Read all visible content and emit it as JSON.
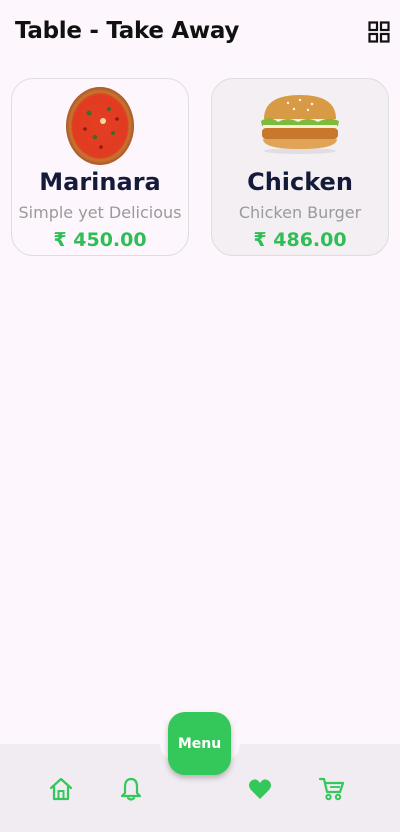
{
  "header": {
    "title": "Table - Take Away",
    "grid_icon": "grid-view-icon"
  },
  "products": [
    {
      "name": "Marinara",
      "description": "Simple yet Delicious",
      "price": "₹ 450.00",
      "image": "pizza-image"
    },
    {
      "name": "Chicken",
      "description": "Chicken Burger",
      "price": "₹ 486.00",
      "image": "burger-image"
    }
  ],
  "bottom_nav": {
    "menu_label": "Menu",
    "items": [
      "home-icon",
      "bell-icon",
      "heart-icon",
      "cart-icon"
    ]
  },
  "colors": {
    "accent": "#34c759",
    "price": "#2fbe55",
    "background": "#fdf6fd",
    "nav_background": "#f1ecf2",
    "title": "#141b3a"
  }
}
